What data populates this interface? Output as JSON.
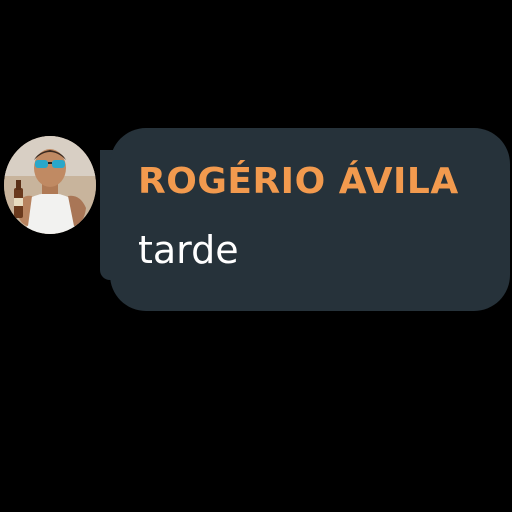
{
  "message": {
    "sender_name": "ROGÉRIO ÁVILA",
    "text": "tarde",
    "avatar_icon": "profile-photo",
    "colors": {
      "bubble_background": "#26323a",
      "sender_name": "#f29a4e",
      "message_text": "#ffffff",
      "page_background": "#000000"
    }
  }
}
